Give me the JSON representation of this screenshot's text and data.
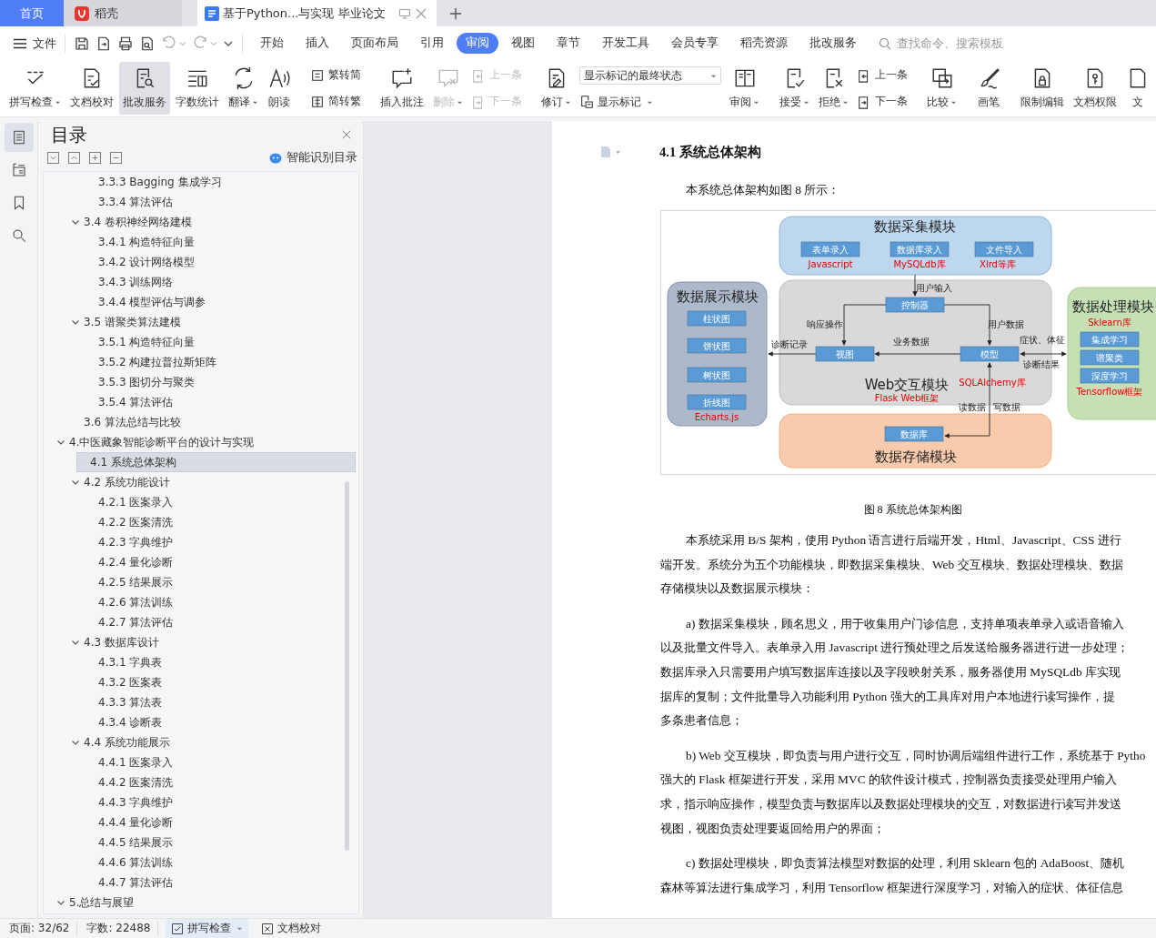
{
  "tabs": [
    {
      "kind": "home",
      "label": "首页",
      "selected": false
    },
    {
      "kind": "app",
      "label": "稻壳",
      "selected": false
    },
    {
      "kind": "doc",
      "label": "基于Python...与实现 毕业论文",
      "selected": true
    }
  ],
  "file_menu": "文件",
  "quick_actions": [
    {
      "disabled": false
    },
    {
      "disabled": false
    },
    {
      "disabled": false
    },
    {
      "disabled": false
    },
    {
      "disabled": true
    },
    {
      "disabled": true
    }
  ],
  "menu_tabs": [
    {
      "label": "开始",
      "selected": false
    },
    {
      "label": "插入",
      "selected": false
    },
    {
      "label": "页面布局",
      "selected": false
    },
    {
      "label": "引用",
      "selected": false
    },
    {
      "label": "审阅",
      "selected": true
    },
    {
      "label": "视图",
      "selected": false
    },
    {
      "label": "章节",
      "selected": false
    },
    {
      "label": "开发工具",
      "selected": false
    },
    {
      "label": "会员专享",
      "selected": false
    },
    {
      "label": "稻壳资源",
      "selected": false
    },
    {
      "label": "批改服务",
      "selected": false
    }
  ],
  "command_search": {
    "placeholder": "查找命令、搜索模板"
  },
  "ribbon": [
    {
      "kind": "big",
      "label": "拼写检查",
      "dropdown": true,
      "pressed": false,
      "disabled": false
    },
    {
      "kind": "big",
      "label": "文档校对",
      "dropdown": false,
      "pressed": false,
      "disabled": false
    },
    {
      "kind": "big",
      "label": "批改服务",
      "dropdown": false,
      "pressed": true,
      "disabled": false
    },
    {
      "kind": "big",
      "label": "字数统计",
      "dropdown": false,
      "pressed": false,
      "disabled": false
    },
    {
      "kind": "big",
      "label": "翻译",
      "dropdown": true,
      "pressed": false,
      "disabled": false
    },
    {
      "kind": "big",
      "label": "朗读",
      "dropdown": false,
      "pressed": false,
      "disabled": false
    },
    {
      "kind": "separator"
    },
    {
      "kind": "pair",
      "top": {
        "label": "繁转简",
        "disabled": false
      },
      "bottom": {
        "label": "简转繁",
        "disabled": false
      }
    },
    {
      "kind": "separator"
    },
    {
      "kind": "big",
      "label": "插入批注",
      "dropdown": false,
      "pressed": false,
      "disabled": false
    },
    {
      "kind": "big",
      "label": "删除",
      "dropdown": true,
      "pressed": false,
      "disabled": true
    },
    {
      "kind": "pair",
      "top": {
        "label": "上一条",
        "disabled": true
      },
      "bottom": {
        "label": "下一条",
        "disabled": true
      }
    },
    {
      "kind": "separator"
    },
    {
      "kind": "big",
      "label": "修订",
      "dropdown": true,
      "pressed": false,
      "disabled": false
    },
    {
      "kind": "combo",
      "value": "显示标记的最终状态",
      "below": "显示标记"
    },
    {
      "kind": "big",
      "label": "审阅",
      "dropdown": true,
      "pressed": false,
      "disabled": false
    },
    {
      "kind": "separator"
    },
    {
      "kind": "big",
      "label": "接受",
      "dropdown": true,
      "pressed": false,
      "disabled": false
    },
    {
      "kind": "big",
      "label": "拒绝",
      "dropdown": true,
      "pressed": false,
      "disabled": false
    },
    {
      "kind": "pair",
      "top": {
        "label": "上一条",
        "disabled": false
      },
      "bottom": {
        "label": "下一条",
        "disabled": false
      }
    },
    {
      "kind": "separator"
    },
    {
      "kind": "big",
      "label": "比较",
      "dropdown": true,
      "pressed": false,
      "disabled": false
    },
    {
      "kind": "separator"
    },
    {
      "kind": "big",
      "label": "画笔",
      "dropdown": false,
      "pressed": false,
      "disabled": false
    },
    {
      "kind": "separator"
    },
    {
      "kind": "big",
      "label": "限制编辑",
      "dropdown": false,
      "pressed": false,
      "disabled": false
    },
    {
      "kind": "big",
      "label": "文档权限",
      "dropdown": false,
      "pressed": false,
      "disabled": false
    },
    {
      "kind": "big",
      "label": "文",
      "dropdown": false,
      "pressed": false,
      "disabled": false
    }
  ],
  "side_tabs": [
    {
      "selected": true
    },
    {
      "selected": false
    },
    {
      "selected": false
    },
    {
      "selected": false
    }
  ],
  "toc": {
    "title": "目录",
    "smart_button": "智能识别目录",
    "items": [
      {
        "children": [
          {
            "children": [
              {
                "label": "3.3.3 Bagging 集成学习",
                "selected": false
              },
              {
                "label": "3.3.4 算法评估",
                "selected": false
              }
            ]
          },
          {
            "label": "3.4 卷积神经网络建模",
            "selected": false,
            "expanded": true,
            "children": [
              {
                "label": "3.4.1 构造特征向量",
                "selected": false
              },
              {
                "label": "3.4.2 设计网络模型",
                "selected": false
              },
              {
                "label": "3.4.3  训练网络",
                "selected": false
              },
              {
                "label": "3.4.4 模型评估与调参",
                "selected": false
              }
            ]
          },
          {
            "label": "3.5 谱聚类算法建模",
            "selected": false,
            "expanded": true,
            "children": [
              {
                "label": "3.5.1 构造特征向量",
                "selected": false
              },
              {
                "label": "3.5.2 构建拉普拉斯矩阵",
                "selected": false
              },
              {
                "label": "3.5.3 图切分与聚类",
                "selected": false
              },
              {
                "label": "3.5.4 算法评估",
                "selected": false
              }
            ]
          },
          {
            "label": "3.6 算法总结与比较",
            "selected": false
          }
        ]
      },
      {
        "label": "4.中医藏象智能诊断平台的设计与实现",
        "selected": false,
        "expanded": true,
        "children": [
          {
            "label": "4.1 系统总体架构",
            "selected": true
          },
          {
            "label": "4.2 系统功能设计",
            "selected": false,
            "expanded": true,
            "children": [
              {
                "label": "4.2.1 医案录入",
                "selected": false
              },
              {
                "label": "4.2.2 医案清洗",
                "selected": false
              },
              {
                "label": "4.2.3 字典维护",
                "selected": false
              },
              {
                "label": "4.2.4 量化诊断",
                "selected": false
              },
              {
                "label": "4.2.5 结果展示",
                "selected": false
              },
              {
                "label": "4.2.6 算法训练",
                "selected": false
              },
              {
                "label": "4.2.7 算法评估",
                "selected": false
              }
            ]
          },
          {
            "label": "4.3 数据库设计",
            "selected": false,
            "expanded": true,
            "children": [
              {
                "label": "4.3.1 字典表",
                "selected": false
              },
              {
                "label": "4.3.2 医案表",
                "selected": false
              },
              {
                "label": "4.3.3 算法表",
                "selected": false
              },
              {
                "label": "4.3.4 诊断表",
                "selected": false
              }
            ]
          },
          {
            "label": "4.4 系统功能展示",
            "selected": false,
            "expanded": true,
            "children": [
              {
                "label": "4.4.1 医案录入",
                "selected": false
              },
              {
                "label": "4.4.2 医案清洗",
                "selected": false
              },
              {
                "label": "4.4.3 字典维护",
                "selected": false
              },
              {
                "label": "4.4.4 量化诊断",
                "selected": false
              },
              {
                "label": "4.4.5 结果展示",
                "selected": false
              },
              {
                "label": "4.4.6 算法训练",
                "selected": false
              },
              {
                "label": "4.4.7 算法评估",
                "selected": false
              }
            ]
          }
        ]
      },
      {
        "label": "5.总结与展望",
        "selected": false,
        "expanded": true
      }
    ]
  },
  "document": {
    "heading": "4.1 系统总体架构",
    "intro": "本系统总体架构如图 8 所示：",
    "figure": {
      "modules": [
        {
          "kind": "collect",
          "title": "数据采集模块",
          "nodes": [
            "表单录入",
            "数据库录入",
            "文件导入"
          ],
          "notes": [
            "Javascript",
            "MySQLdb库",
            "Xlrd等库"
          ]
        },
        {
          "kind": "display",
          "title": "数据展示模块",
          "nodes": [
            "柱状图",
            "饼状图",
            "树状图",
            "折线图"
          ],
          "notes": [
            "Echarts.js"
          ]
        },
        {
          "kind": "web",
          "title": "Web交互模块",
          "nodes": [
            "控制器",
            "视图",
            "模型"
          ],
          "notes": [
            "Flask Web框架",
            "SQLAlchemy库"
          ]
        },
        {
          "kind": "process",
          "title": "数据处理模块",
          "nodes": [
            "集成学习",
            "谱聚类",
            "深度学习"
          ],
          "notes": [
            "Sklearn库",
            "Tensorflow框架"
          ]
        },
        {
          "kind": "storage",
          "title": "数据存储模块",
          "nodes": [
            "数据库"
          ]
        }
      ],
      "edge_labels": [
        "用户输入",
        "响应操作",
        "用户数据",
        "诊断记录",
        "业务数据",
        "症状、体征",
        "诊断结果",
        "读数据",
        "写数据"
      ]
    },
    "caption": "图 8  系统总体架构图",
    "paragraphs": [
      [
        "本系统采用 B/S 架构，使用 Python 语言进行后端开发，Html、Javascript、CSS 进行",
        "端开发。系统分为五个功能模块，即数据采集模块、Web 交互模块、数据处理模块、数据",
        "存储模块以及数据展示模块："
      ],
      [
        "a) 数据采集模块，顾名思义，用于收集用户门诊信息，支持单项表单录入或语音输入",
        "以及批量文件导入。表单录入用 Javascript 进行预处理之后发送给服务器进行进一步处理；",
        "数据库录入只需要用户填写数据库连接以及字段映射关系，服务器使用 MySQLdb 库实现",
        "据库的复制；文件批量导入功能利用 Python 强大的工具库对用户本地进行读写操作，提",
        "多条患者信息；"
      ],
      [
        "b) Web 交互模块，即负责与用户进行交互，同时协调后端组件进行工作，系统基于 Pytho",
        "强大的 Flask 框架进行开发，采用 MVC 的软件设计模式，控制器负责接受处理用户输入",
        "求，指示响应操作，模型负责与数据库以及数据处理模块的交互，对数据进行读写并发送",
        "视图，视图负责处理要返回给用户的界面；"
      ],
      [
        "c) 数据处理模块，即负责算法模型对数据的处理，利用 Sklearn 包的 AdaBoost、随机",
        "森林等算法进行集成学习，利用 Tensorflow 框架进行深度学习，对输入的症状、体征信息"
      ]
    ]
  },
  "status_bar": [
    {
      "kind": "text",
      "label": "页面: 32/62"
    },
    {
      "kind": "text",
      "label": "字数: 22488"
    },
    {
      "kind": "spell",
      "label": "拼写检查"
    },
    {
      "kind": "proof",
      "label": "文档校对"
    }
  ]
}
